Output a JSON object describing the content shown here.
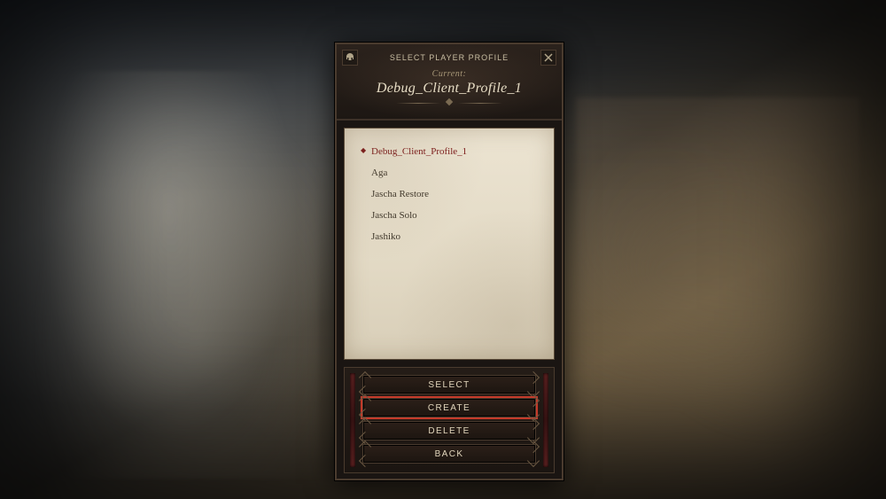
{
  "header": {
    "title": "SELECT PLAYER PROFILE",
    "current_label": "Current:",
    "current_profile": "Debug_Client_Profile_1"
  },
  "profiles": [
    {
      "name": "Debug_Client_Profile_1",
      "selected": true
    },
    {
      "name": "Aga",
      "selected": false
    },
    {
      "name": "Jascha Restore",
      "selected": false
    },
    {
      "name": "Jascha Solo",
      "selected": false
    },
    {
      "name": "Jashiko",
      "selected": false
    }
  ],
  "buttons": {
    "select": "SELECT",
    "create": "CREATE",
    "delete": "DELETE",
    "back": "BACK"
  },
  "highlighted_button": "create"
}
